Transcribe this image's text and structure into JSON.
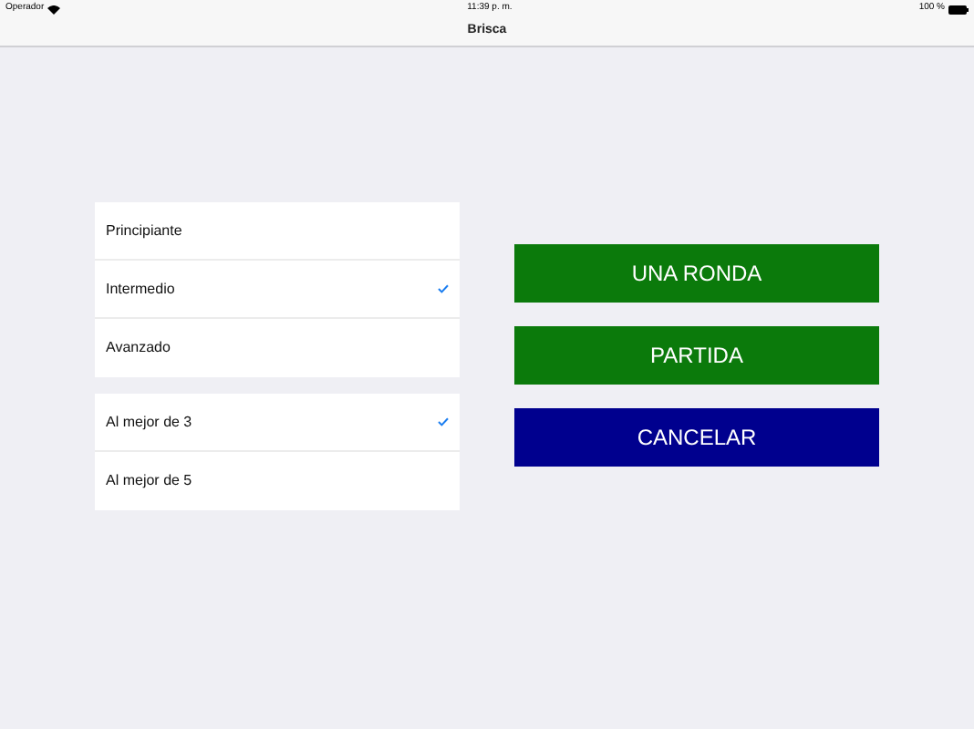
{
  "status_bar": {
    "carrier": "Operador",
    "time": "11:39 p. m.",
    "battery": "100 %"
  },
  "navigation_bar": {
    "title": "Brisca"
  },
  "groups": [
    {
      "items": [
        {
          "label": "Principiante",
          "selected": false
        },
        {
          "label": "Intermedio",
          "selected": true
        },
        {
          "label": "Avanzado",
          "selected": false
        }
      ]
    },
    {
      "items": [
        {
          "label": "Al mejor de 3",
          "selected": true
        },
        {
          "label": "Al mejor de 5",
          "selected": false
        }
      ]
    }
  ],
  "buttons": [
    {
      "label": "UNA RONDA",
      "color": "#0b7a0b"
    },
    {
      "label": "PARTIDA",
      "color": "#0b7a0b"
    },
    {
      "label": "CANCELAR",
      "color": "#00008e"
    }
  ]
}
